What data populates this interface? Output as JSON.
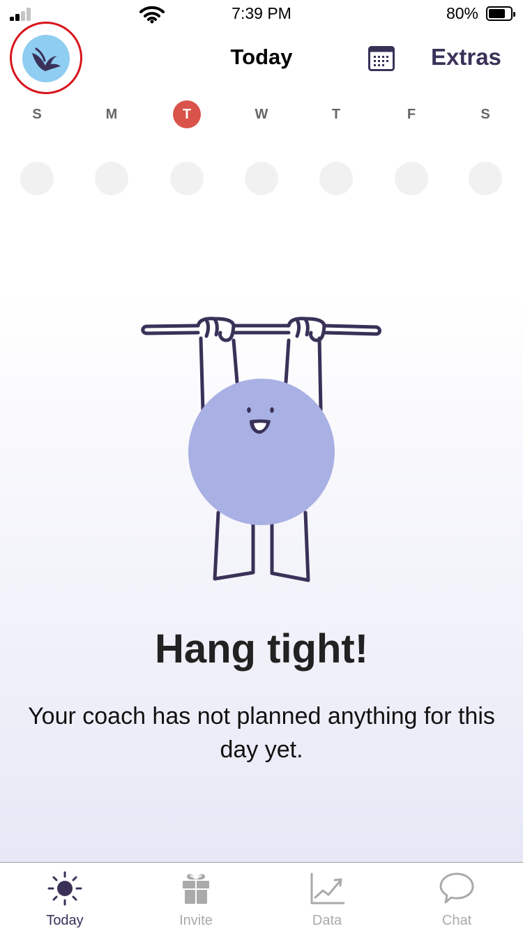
{
  "status_bar": {
    "time": "7:39 PM",
    "battery_percent": "80%",
    "battery_level": 0.8
  },
  "header": {
    "title": "Today",
    "extras_label": "Extras",
    "avatar_icon": "bird-logo-icon",
    "calendar_icon": "calendar-icon"
  },
  "week": {
    "days": [
      {
        "letter": "S",
        "selected": false
      },
      {
        "letter": "M",
        "selected": false
      },
      {
        "letter": "T",
        "selected": true
      },
      {
        "letter": "W",
        "selected": false
      },
      {
        "letter": "T",
        "selected": false
      },
      {
        "letter": "F",
        "selected": false
      },
      {
        "letter": "S",
        "selected": false
      }
    ]
  },
  "empty_state": {
    "heading": "Hang tight!",
    "message": "Your coach has not planned anything for this day yet.",
    "illustration": "hanging-character"
  },
  "tabbar": {
    "tabs": [
      {
        "label": "Today",
        "icon": "sun-icon",
        "active": true
      },
      {
        "label": "Invite",
        "icon": "gift-icon",
        "active": false
      },
      {
        "label": "Data",
        "icon": "chart-icon",
        "active": false
      },
      {
        "label": "Chat",
        "icon": "chat-bubble-icon",
        "active": false
      }
    ]
  },
  "colors": {
    "accent": "#3a3158",
    "selected_day": "#d9534a",
    "character": "#a9b0e3",
    "avatar_bg": "#8fcdf1",
    "highlight_ring": "#d8141b"
  }
}
